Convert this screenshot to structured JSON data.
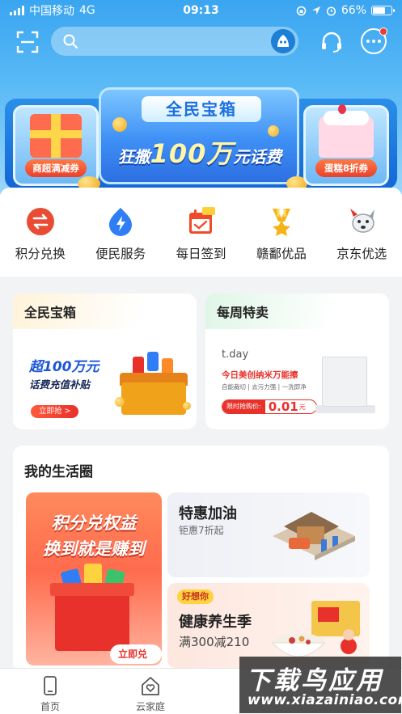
{
  "status_bar": {
    "carrier": "中国移动",
    "network": "4G",
    "time": "09:13",
    "battery_percent": "66%",
    "battery_level": 0.66
  },
  "search": {
    "placeholder": ""
  },
  "banner": {
    "tag": "全民宝箱",
    "headline_prefix": "狂撒",
    "headline_amount": "100万",
    "headline_suffix": "元话费",
    "left_label": "商超满减券",
    "right_label": "蛋糕8折券"
  },
  "quick_nav": [
    {
      "label": "积分兑换",
      "icon": "exchange-icon",
      "color": "#e94b35"
    },
    {
      "label": "便民服务",
      "icon": "lightning-icon",
      "color": "#2f7ef5"
    },
    {
      "label": "每日签到",
      "icon": "calendar-icon",
      "color": "#f04a2a"
    },
    {
      "label": "赣鄱优品",
      "icon": "medal-icon",
      "color": "#f5b31a"
    },
    {
      "label": "京东优选",
      "icon": "jd-dog-icon",
      "color": "#9aa0a8"
    }
  ],
  "featured": {
    "treasure": {
      "title": "全民宝箱",
      "promo_line1": "超100万元",
      "promo_line2": "话费充值补贴",
      "button": "立即抢 >"
    },
    "weekly": {
      "title": "每周特卖",
      "brand": "t.day",
      "promo_line1": "今日美创纳米万能擦",
      "promo_line2": "自能裁切 | 去污力强 | 一洗即净",
      "price_label": "限时抢购价:",
      "price_value": "0.01",
      "price_unit": "元"
    }
  },
  "life_circle": {
    "title": "我的生活圈",
    "big_card": {
      "line1": "积分兑权益",
      "line2": "换到就是赚到",
      "button": "立即兑换 >"
    },
    "fuel": {
      "title": "特惠加油",
      "subtitle": "钜惠7折起"
    },
    "health": {
      "badge": "好想你",
      "title": "健康养生季",
      "subtitle": "满300减210"
    }
  },
  "tabbar": [
    {
      "label": "首页",
      "icon": "phone-icon"
    },
    {
      "label": "云家庭",
      "icon": "home-heart-icon"
    },
    {
      "label": "",
      "icon": "tab-icon"
    },
    {
      "label": "",
      "icon": "tab-icon"
    }
  ],
  "watermark": {
    "title": "下载鸟应用",
    "url": "www.xiazainiao.com"
  }
}
